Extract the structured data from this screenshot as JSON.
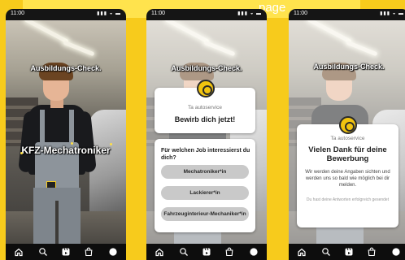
{
  "banner": {
    "text": "page"
  },
  "status": {
    "time": "11:00",
    "icons": "▮▮▮ ◒ ▬"
  },
  "screen1": {
    "caption_top": "Ausbildungs-Check.",
    "caption_center": "KFZ-Mechatroniker"
  },
  "screen2": {
    "caption_top": "Ausbildungs-Check.",
    "header_card": {
      "account": "Ta autoservice",
      "title": "Bewirb dich jetzt!"
    },
    "question_card": {
      "question": "Für welchen Job interessierst du dich?",
      "options": [
        "Mechatroniker*in",
        "Lackierer*in",
        "Fahrzeuginterieur-Mechaniker*in"
      ]
    }
  },
  "screen3": {
    "caption_top": "Ausbildungs-Check.",
    "card": {
      "account": "Ta autoservice",
      "title_line1": "Vielen Dank für deine",
      "title_line2": "Bewerbung",
      "body": "Wir werden deine Angaben sichten und werden uns so bald wie möglich bei dir melden.",
      "note": "Du hast deine Antworten erfolgreich gesendet"
    }
  },
  "nav": {
    "items": [
      "home-icon",
      "search-icon",
      "create-icon",
      "shop-icon",
      "profile-icon"
    ]
  },
  "colors": {
    "background": "#f7cb1c",
    "banner": "#ffe34d",
    "logo": "#f2c40f",
    "option": "#c9c9c9"
  }
}
